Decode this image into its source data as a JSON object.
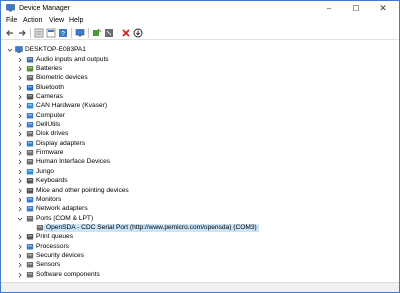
{
  "window": {
    "title": "Device Manager",
    "controls": {
      "minimize": "–",
      "maximize": "☐",
      "close": "✕"
    }
  },
  "menu": {
    "file": "File",
    "action": "Action",
    "view": "View",
    "help": "Help"
  },
  "toolbar": {
    "icons": [
      "back-arrow-icon",
      "forward-arrow-icon",
      "properties-icon",
      "show-hidden-icon",
      "help-icon",
      "scan-hardware-icon",
      "update-driver-icon",
      "disable-device-icon",
      "uninstall-device-icon",
      "download-driver-icon"
    ]
  },
  "tree": {
    "root": "DESKTOP-E083PA1",
    "categories": [
      {
        "label": "Audio inputs and outputs",
        "icon": "speaker-icon",
        "color": "#4a6fa5"
      },
      {
        "label": "Batteries",
        "icon": "battery-icon",
        "color": "#5b8c3a"
      },
      {
        "label": "Biometric devices",
        "icon": "fingerprint-icon",
        "color": "#6a6a6a"
      },
      {
        "label": "Bluetooth",
        "icon": "bluetooth-icon",
        "color": "#1f6fd1"
      },
      {
        "label": "Cameras",
        "icon": "camera-icon",
        "color": "#555555"
      },
      {
        "label": "CAN Hardware (Kvaser)",
        "icon": "can-hardware-icon",
        "color": "#2b8fd6"
      },
      {
        "label": "Computer",
        "icon": "computer-icon",
        "color": "#3d7cc9"
      },
      {
        "label": "DellUtils",
        "icon": "dellutils-icon",
        "color": "#3d7cc9"
      },
      {
        "label": "Disk drives",
        "icon": "disk-drive-icon",
        "color": "#6d6d6d"
      },
      {
        "label": "Display adapters",
        "icon": "display-adapter-icon",
        "color": "#3d7cc9"
      },
      {
        "label": "Firmware",
        "icon": "firmware-icon",
        "color": "#6d6d6d"
      },
      {
        "label": "Human Interface Devices",
        "icon": "hid-icon",
        "color": "#6d6d6d"
      },
      {
        "label": "Jungo",
        "icon": "jungo-icon",
        "color": "#2b8fd6"
      },
      {
        "label": "Keyboards",
        "icon": "keyboard-icon",
        "color": "#555555"
      },
      {
        "label": "Mice and other pointing devices",
        "icon": "mouse-icon",
        "color": "#555555"
      },
      {
        "label": "Monitors",
        "icon": "monitor-icon",
        "color": "#3d7cc9"
      },
      {
        "label": "Network adapters",
        "icon": "network-adapter-icon",
        "color": "#3d7cc9"
      },
      {
        "label": "Ports (COM & LPT)",
        "icon": "port-icon",
        "color": "#6d6d6d",
        "expanded": true
      },
      {
        "label": "OpenSDA - CDC Serial Port (http://www.pemicro.com/opensda) (COM3)",
        "icon": "serial-port-icon",
        "color": "#6d6d6d",
        "child": true,
        "selected": true
      },
      {
        "label": "Print queues",
        "icon": "printer-icon",
        "color": "#555555"
      },
      {
        "label": "Processors",
        "icon": "processor-icon",
        "color": "#3d7cc9"
      },
      {
        "label": "Security devices",
        "icon": "security-device-icon",
        "color": "#6d6d6d"
      },
      {
        "label": "Sensors",
        "icon": "sensor-icon",
        "color": "#6d6d6d"
      },
      {
        "label": "Software components",
        "icon": "software-component-icon",
        "color": "#6d6d6d"
      }
    ]
  }
}
